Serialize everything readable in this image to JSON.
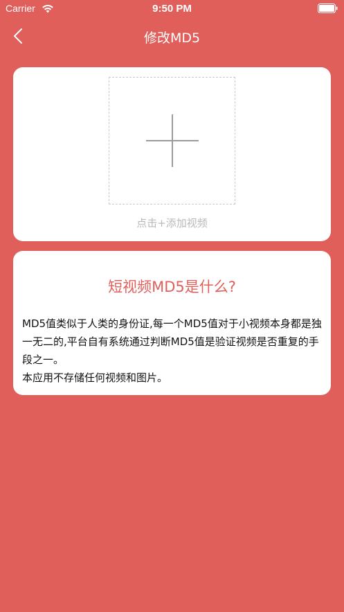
{
  "status_bar": {
    "carrier": "Carrier",
    "time": "9:50 PM"
  },
  "nav": {
    "title": "修改MD5"
  },
  "upload": {
    "hint": "点击+添加视频"
  },
  "info": {
    "title": "短视频MD5是什么?",
    "paragraphs": [
      "MD5值类似于人类的身份证,每一个MD5值对于小视频本身都是独一无二的,平台自有系统通过判断MD5值是验证视频是否重复的手段之一。",
      "本应用不存储任何视频和图片。"
    ]
  },
  "icons": {
    "back": "chevron-left-icon",
    "wifi": "wifi-icon",
    "battery": "battery-icon",
    "plus": "plus-icon"
  },
  "colors": {
    "background": "#E05F5A",
    "card": "#FFFFFF",
    "accent": "#E05F5A",
    "hint": "#B8B8B8",
    "body_text": "#111111"
  }
}
